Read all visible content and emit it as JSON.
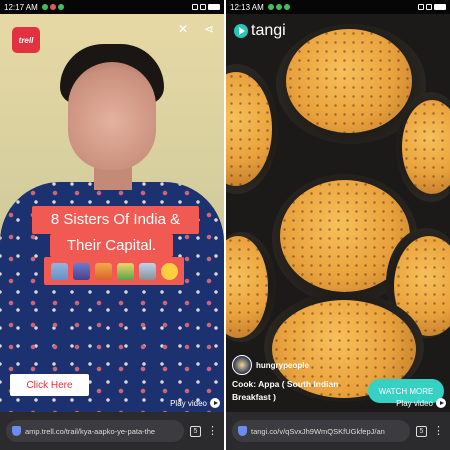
{
  "left": {
    "status": {
      "time": "12:17 AM"
    },
    "logo_text": "trell",
    "caption_line1": "8 Sisters Of India &",
    "caption_line2": "Their Capital.",
    "click_here": "Click Here",
    "play_video": "Play video",
    "url": "amp.trell.co/trail/kya-aapko-ye-pata-the",
    "tab_count": "5"
  },
  "right": {
    "status": {
      "time": "12:13 AM"
    },
    "logo_text": "tangi",
    "creator": "hungrypeople",
    "cook_text": "Cook: Appa ( South Indian Breakfast )",
    "watch_more": "WATCH MORE",
    "play_video": "Play video",
    "url": "tangi.co/v/qSvxJh9WmQSKfUGkfepJ/an",
    "tab_count": "5"
  },
  "colors": {
    "caption_bg": "#f05a52",
    "trell_red": "#e2323f",
    "tangi_teal": "#36d1c2"
  },
  "icons": {
    "mute": "volume-mute-icon",
    "share": "share-icon",
    "shield": "shield-icon",
    "play": "play-icon"
  }
}
